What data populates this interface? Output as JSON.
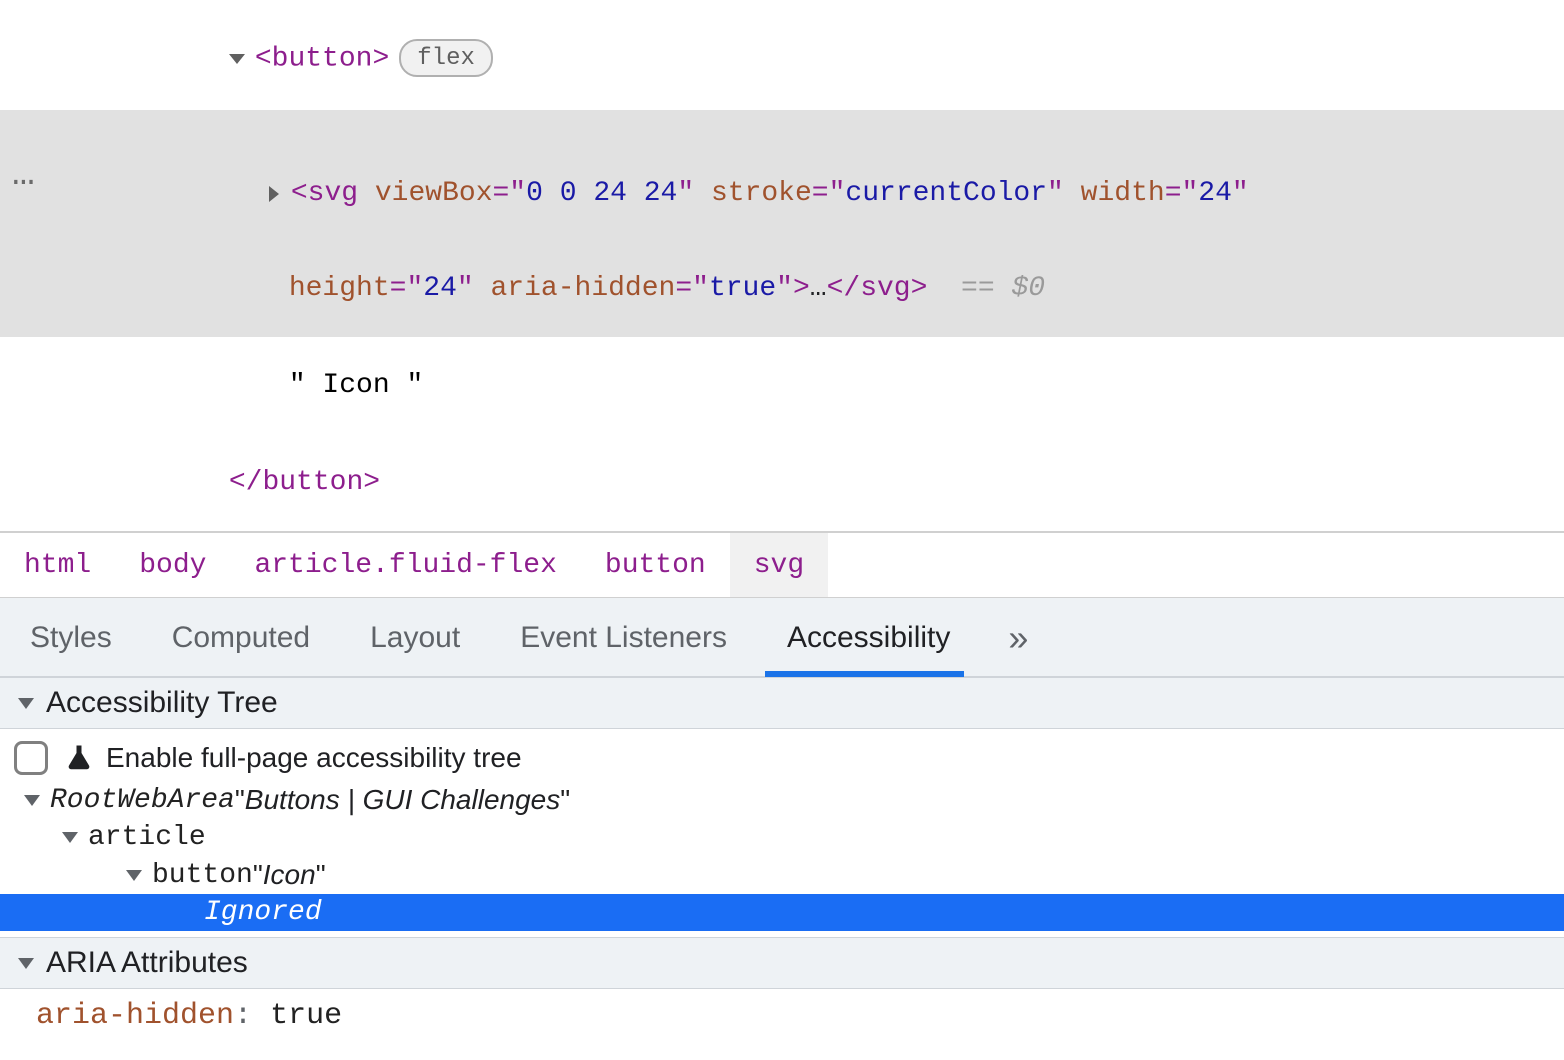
{
  "elements": {
    "button_open": "<button>",
    "flex_badge": "flex",
    "svg_line1_parts": {
      "open": "<",
      "name": "svg",
      "attrs": [
        {
          "name": "viewBox",
          "value": "0 0 24 24"
        },
        {
          "name": "stroke",
          "value": "currentColor"
        },
        {
          "name": "width",
          "value": "24"
        }
      ],
      "line2_attrs": [
        {
          "name": "height",
          "value": "24"
        },
        {
          "name": "aria-hidden",
          "value": "true"
        }
      ],
      "ellipsis": "…",
      "close_name": "svg",
      "eq0": "== $0"
    },
    "text_node": "\" Icon \"",
    "button_close": "</button>"
  },
  "breadcrumb": [
    "html",
    "body",
    "article.fluid-flex",
    "button",
    "svg"
  ],
  "tabs": [
    "Styles",
    "Computed",
    "Layout",
    "Event Listeners",
    "Accessibility"
  ],
  "overflow_glyph": "»",
  "sections": {
    "a11y_tree_header": "Accessibility Tree",
    "enable_full_page": "Enable full-page accessibility tree",
    "aria_header": "ARIA Attributes"
  },
  "a11y_tree": {
    "root_role": "RootWebArea",
    "root_name": "Buttons | GUI Challenges",
    "article_role": "article",
    "button_role": "button",
    "button_name": "Icon",
    "ignored_label": "Ignored"
  },
  "aria_attrs": {
    "key": "aria-hidden",
    "value": "true"
  }
}
